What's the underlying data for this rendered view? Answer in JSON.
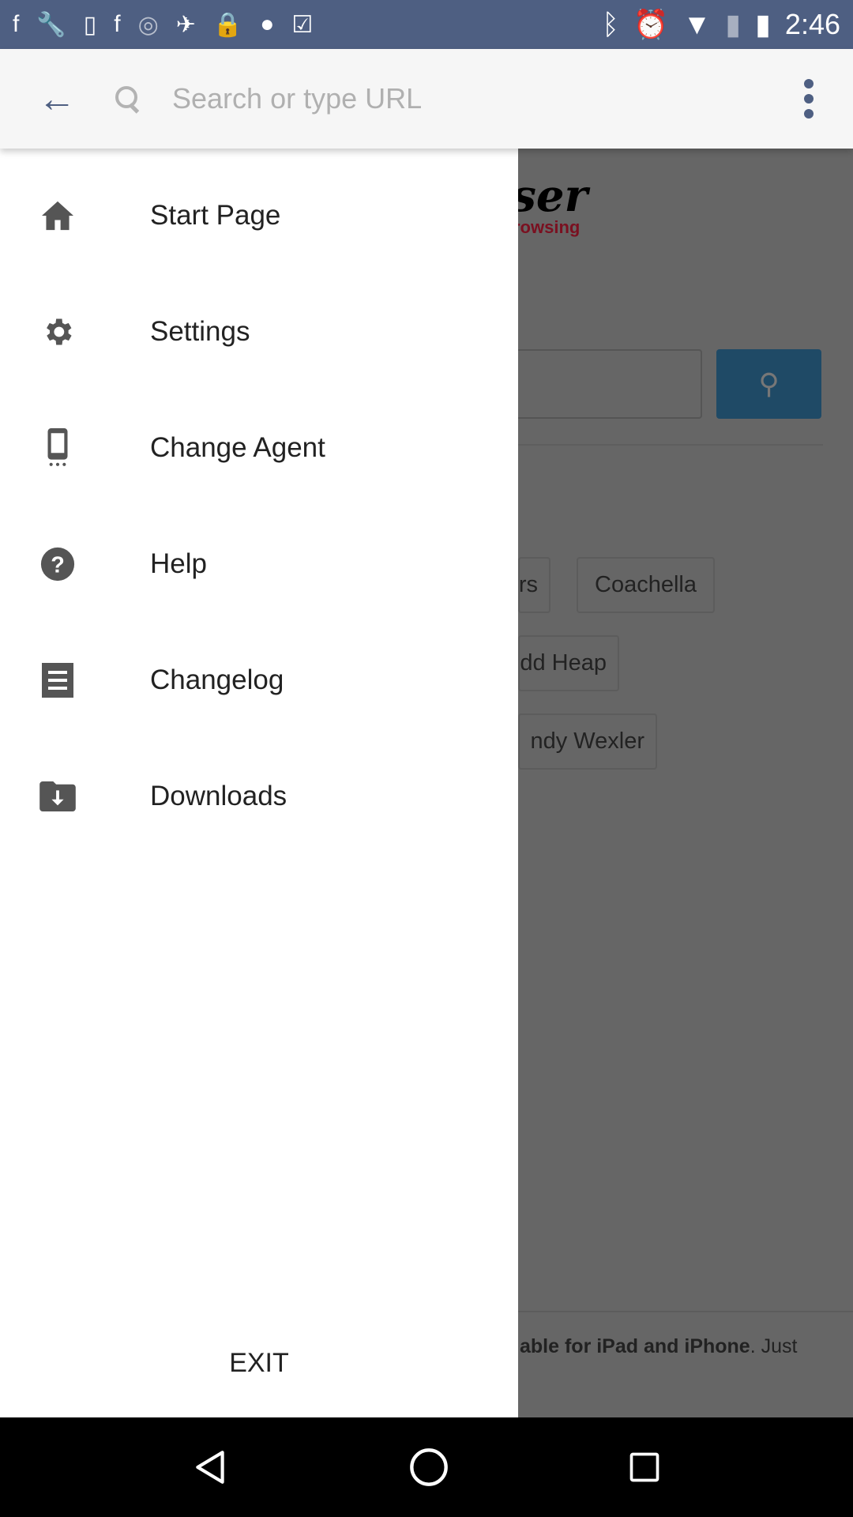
{
  "status_bar": {
    "time": "2:46",
    "left_icons": [
      "facebook-icon",
      "wrench-icon",
      "sim-icon",
      "facebook-icon",
      "circle-icon",
      "fake-gps-icon",
      "lock-icon",
      "android-icon",
      "clipboard-icon"
    ],
    "right_icons": [
      "bluetooth-icon",
      "alarm-icon",
      "wifi-icon",
      "no-sim-icon",
      "battery-charging-icon"
    ]
  },
  "toolbar": {
    "search_placeholder": "Search or type URL"
  },
  "drawer": {
    "items": [
      {
        "label": "Start Page",
        "icon": "home-icon"
      },
      {
        "label": "Settings",
        "icon": "gear-icon"
      },
      {
        "label": "Change Agent",
        "icon": "phone-icon"
      },
      {
        "label": "Help",
        "icon": "help-icon"
      },
      {
        "label": "Changelog",
        "icon": "receipt-icon"
      },
      {
        "label": "Downloads",
        "icon": "download-folder-icon"
      }
    ],
    "exit_label": "EXIT"
  },
  "background_page": {
    "logo_text": "oser",
    "logo_tagline": "rowsing",
    "chips": [
      "rs",
      "Coachella",
      "dd Heap",
      "ndy Wexler"
    ],
    "footer_bold": "able for iPad and iPhone",
    "footer_rest": ". Just"
  },
  "colors": {
    "status_bar": "#4e5f82",
    "accent": "#4e5f82",
    "search_button": "#3b87c0"
  }
}
